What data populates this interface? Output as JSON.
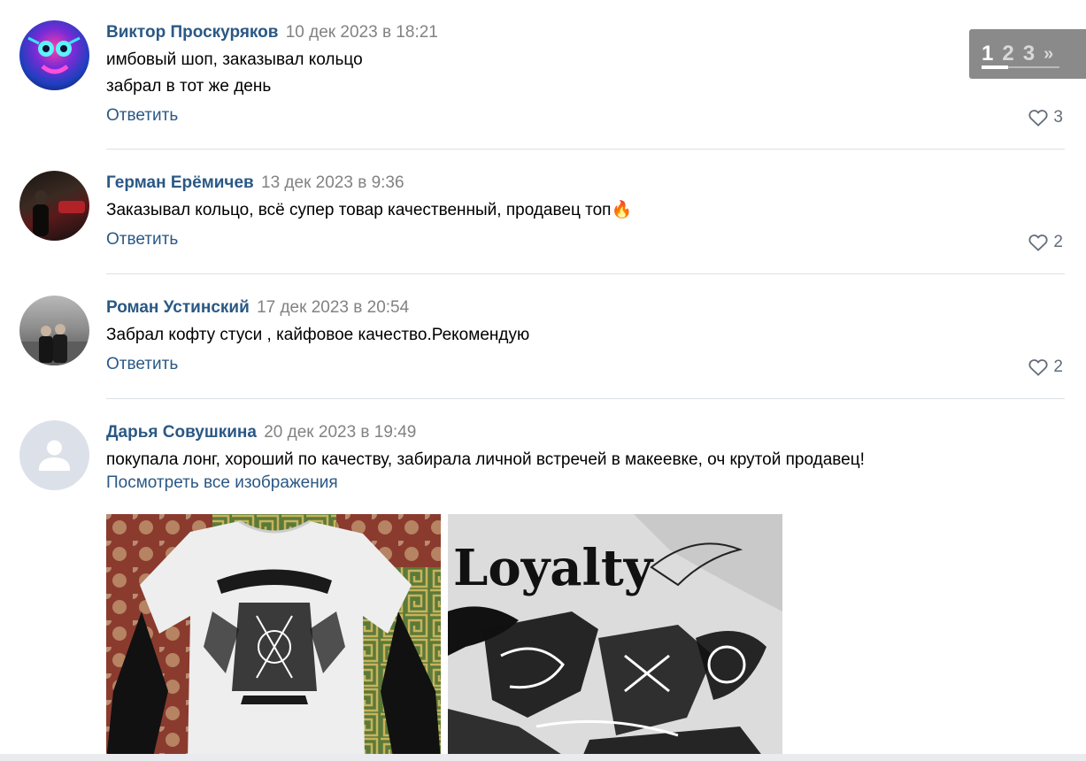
{
  "pager": {
    "pages": [
      "1",
      "2",
      "3"
    ],
    "next": "»",
    "active": "1"
  },
  "comments": [
    {
      "author": "Виктор Проскуряков",
      "date": "10 дек 2023 в 18:21",
      "lines": [
        "имбовый шоп, заказывал кольцо",
        "забрал в тот же день"
      ],
      "reply": "Ответить",
      "likes": "3"
    },
    {
      "author": "Герман Ерёмичев",
      "date": "13 дек 2023 в 9:36",
      "lines": [
        "Заказывал кольцо, всё супер товар качественный, продавец топ"
      ],
      "emoji": "🔥",
      "reply": "Ответить",
      "likes": "2"
    },
    {
      "author": "Роман Устинский",
      "date": "17 дек 2023 в 20:54",
      "lines": [
        "Забрал кофту стуси , кайфовое качество.Рекомендую"
      ],
      "reply": "Ответить",
      "likes": "2"
    },
    {
      "author": "Дарья Совушкина",
      "date": "20 дек 2023 в 19:49",
      "lines": [
        "покупала лонг, хороший по качеству, забирала личной встречей в макеевке, оч крутой продавец!"
      ],
      "view_all": "Посмотреть все изображения"
    }
  ],
  "photo_print_text": "Loyalty",
  "colors": {
    "link": "#2a5885",
    "date": "#828282",
    "divider": "#dce1e6",
    "like": "#626d7a",
    "pager_bg": "#8a8a8a"
  },
  "icons": {
    "like": "heart-icon",
    "default_avatar": "user-icon"
  }
}
